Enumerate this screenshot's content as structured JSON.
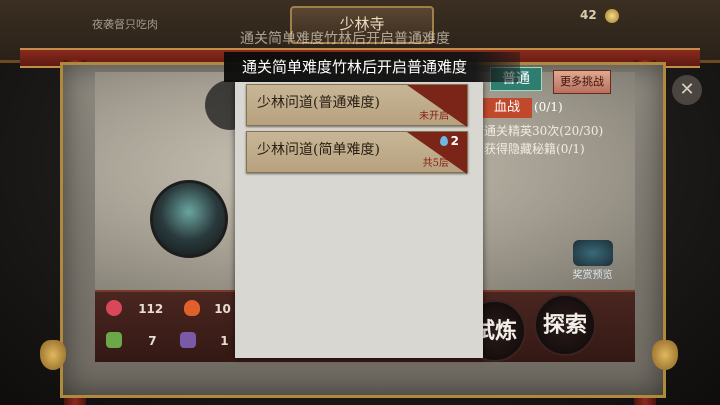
{
  "header": {
    "title": "少林寺",
    "subtitle_ghost": "通关简单难度竹林后开启普通难度",
    "top_left_text": "夜袭督只吃肉",
    "currency_amount": "42"
  },
  "tooltip": {
    "message": "通关简单难度竹林后开启普通难度"
  },
  "stage_list": [
    {
      "name": "少林问道(普通难度)",
      "status": "未开启",
      "badge": ""
    },
    {
      "name": "少林问道(简单难度)",
      "status": "共5层",
      "badge": "2"
    }
  ],
  "right_panel": {
    "normal_tab": "普通",
    "more_button": "更多挑战",
    "blood_tab": "血战",
    "progress_1": "(0/1)",
    "task_2": "通关精英30次",
    "progress_2": "(20/30)",
    "task_3": "获得隐藏秘籍",
    "progress_3": "(0/1)",
    "preview_label": "奖赏预览"
  },
  "stats": {
    "hp": "112",
    "attack": "10",
    "speed": "7",
    "defense": "1"
  },
  "actions": {
    "train": "试炼",
    "explore": "探索"
  },
  "icons": {
    "close": "close-icon",
    "hp": "heart-icon",
    "attack": "flame-icon",
    "speed": "boot-icon",
    "defense": "armor-icon",
    "drop": "water-drop-icon"
  },
  "colors": {
    "accent_red": "#7b2418",
    "teal_tab": "#2e7d6e",
    "card": "#c7b696"
  }
}
